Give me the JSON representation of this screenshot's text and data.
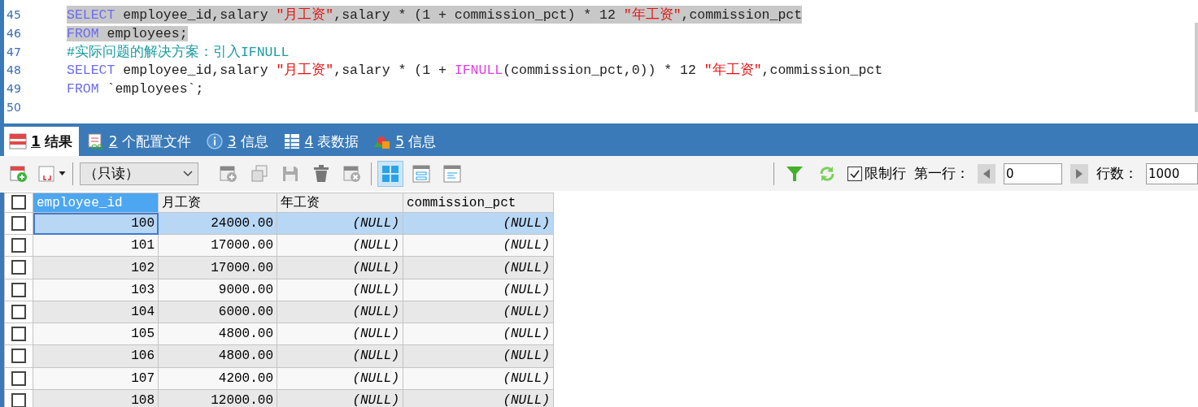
{
  "editor": {
    "lines": [
      {
        "number": "45",
        "highlighted": true,
        "tokens": [
          {
            "kind": "keyword",
            "text": "SELECT"
          },
          {
            "kind": "plain",
            "text": " employee_id,salary "
          },
          {
            "kind": "string",
            "text": "\"月工资\""
          },
          {
            "kind": "plain",
            "text": ",salary * (1 + commission_pct) * 12 "
          },
          {
            "kind": "string",
            "text": "\"年工资\""
          },
          {
            "kind": "plain",
            "text": ",commission_pct"
          }
        ]
      },
      {
        "number": "46",
        "highlighted": true,
        "tokens": [
          {
            "kind": "keyword",
            "text": "FROM"
          },
          {
            "kind": "plain",
            "text": " employees;"
          }
        ]
      },
      {
        "number": "47",
        "highlighted": false,
        "tokens": [
          {
            "kind": "comment",
            "text": "#实际问题的解决方案：引入IFNULL"
          }
        ]
      },
      {
        "number": "48",
        "highlighted": false,
        "tokens": [
          {
            "kind": "keyword",
            "text": "SELECT"
          },
          {
            "kind": "plain",
            "text": " employee_id,salary "
          },
          {
            "kind": "string",
            "text": "\"月工资\""
          },
          {
            "kind": "plain",
            "text": ",salary * (1 + "
          },
          {
            "kind": "function",
            "text": "IFNULL"
          },
          {
            "kind": "plain",
            "text": "(commission_pct,0)) * 12 "
          },
          {
            "kind": "string",
            "text": "\"年工资\""
          },
          {
            "kind": "plain",
            "text": ",commission_pct"
          }
        ]
      },
      {
        "number": "49",
        "highlighted": false,
        "tokens": [
          {
            "kind": "keyword",
            "text": "FROM"
          },
          {
            "kind": "plain",
            "text": " `employees`;"
          }
        ]
      },
      {
        "number": "50"
      }
    ]
  },
  "tabs": [
    {
      "number": "1",
      "label": "结果",
      "selected": true
    },
    {
      "number": "2",
      "label": "个配置文件",
      "selected": false
    },
    {
      "number": "3",
      "label": "信息",
      "selected": false
    },
    {
      "number": "4",
      "label": "表数据",
      "selected": false
    },
    {
      "number": "5",
      "label": "信息",
      "selected": false
    }
  ],
  "toolbar": {
    "mode": "（只读）",
    "limit_rows": {
      "label": "限制行",
      "checked": true
    },
    "first_row": {
      "label": "第一行：",
      "value": "0"
    },
    "row_count": {
      "label": "行数：",
      "value": "1000"
    }
  },
  "table": {
    "header_checked": false,
    "columns": [
      {
        "label": "employee_id",
        "selected": true
      },
      {
        "label": "月工资",
        "selected": false
      },
      {
        "label": "年工资",
        "selected": false
      },
      {
        "label": "commission_pct",
        "selected": false
      }
    ],
    "rows": [
      {
        "selected": true,
        "checked": false,
        "cells": [
          "100",
          "24000.00",
          "(NULL)",
          "(NULL)"
        ]
      },
      {
        "selected": false,
        "checked": false,
        "cells": [
          "101",
          "17000.00",
          "(NULL)",
          "(NULL)"
        ]
      },
      {
        "selected": false,
        "checked": false,
        "cells": [
          "102",
          "17000.00",
          "(NULL)",
          "(NULL)"
        ]
      },
      {
        "selected": false,
        "checked": false,
        "cells": [
          "103",
          "9000.00",
          "(NULL)",
          "(NULL)"
        ]
      },
      {
        "selected": false,
        "checked": false,
        "cells": [
          "104",
          "6000.00",
          "(NULL)",
          "(NULL)"
        ]
      },
      {
        "selected": false,
        "checked": false,
        "cells": [
          "105",
          "4800.00",
          "(NULL)",
          "(NULL)"
        ]
      },
      {
        "selected": false,
        "checked": false,
        "cells": [
          "106",
          "4800.00",
          "(NULL)",
          "(NULL)"
        ]
      },
      {
        "selected": false,
        "checked": false,
        "cells": [
          "107",
          "4200.00",
          "(NULL)",
          "(NULL)"
        ]
      },
      {
        "selected": false,
        "checked": false,
        "cells": [
          "108",
          "12000.00",
          "(NULL)",
          "(NULL)"
        ]
      }
    ]
  }
}
